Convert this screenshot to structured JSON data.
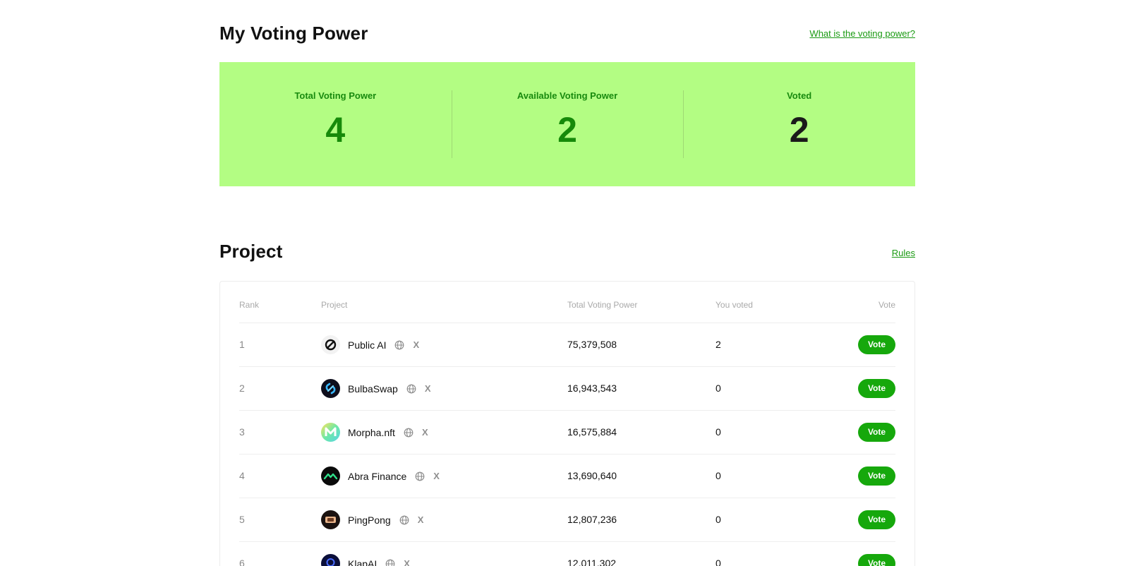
{
  "voting_power": {
    "title": "My Voting Power",
    "help_link": "What is the voting power?",
    "stats": [
      {
        "label": "Total Voting Power",
        "value": "4"
      },
      {
        "label": "Available Voting Power",
        "value": "2"
      },
      {
        "label": "Voted",
        "value": "2"
      }
    ]
  },
  "project": {
    "title": "Project",
    "rules_link": "Rules",
    "columns": {
      "rank": "Rank",
      "project": "Project",
      "total": "Total Voting Power",
      "you_voted": "You voted",
      "vote": "Vote"
    },
    "rows": [
      {
        "rank": "1",
        "name": "Public AI",
        "logo": "public-ai-logo",
        "total": "75,379,508",
        "you_voted": "2",
        "vote_label": "Vote"
      },
      {
        "rank": "2",
        "name": "BulbaSwap",
        "logo": "bulbaswap-logo",
        "total": "16,943,543",
        "you_voted": "0",
        "vote_label": "Vote"
      },
      {
        "rank": "3",
        "name": "Morpha.nft",
        "logo": "morpha-logo",
        "total": "16,575,884",
        "you_voted": "0",
        "vote_label": "Vote"
      },
      {
        "rank": "4",
        "name": "Abra Finance",
        "logo": "abra-finance-logo",
        "total": "13,690,640",
        "you_voted": "0",
        "vote_label": "Vote"
      },
      {
        "rank": "5",
        "name": "PingPong",
        "logo": "pingpong-logo",
        "total": "12,807,236",
        "you_voted": "0",
        "vote_label": "Vote"
      },
      {
        "rank": "6",
        "name": "KlapAI",
        "logo": "klapai-logo",
        "total": "12,011,302",
        "you_voted": "0",
        "vote_label": "Vote"
      }
    ],
    "link_icons": [
      "globe-icon",
      "x-icon"
    ],
    "x_glyph": "X"
  },
  "colors": {
    "accent_green": "#16a80c",
    "card_bg": "#b3fd83",
    "stat_green": "#168a0a"
  }
}
